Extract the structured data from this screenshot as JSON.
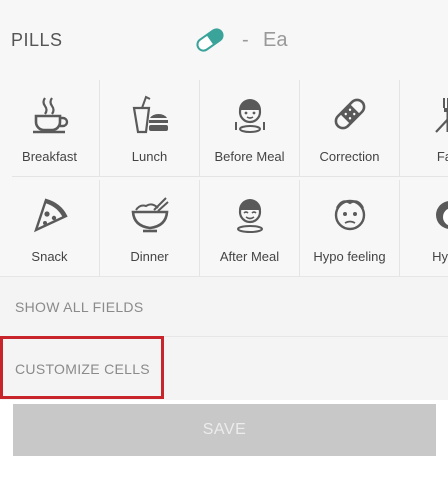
{
  "header": {
    "title": "PILLS",
    "value": "Ea",
    "separator": "-"
  },
  "cells": [
    {
      "label": "Breakfast",
      "icon": "coffee-cup-icon"
    },
    {
      "label": "Lunch",
      "icon": "burger-drink-icon"
    },
    {
      "label": "Before Meal",
      "icon": "person-before-meal-icon"
    },
    {
      "label": "Correction",
      "icon": "bandage-icon"
    },
    {
      "label": "Fast",
      "icon": "fork-knife-icon"
    },
    {
      "label": "Snack",
      "icon": "pizza-slice-icon"
    },
    {
      "label": "Dinner",
      "icon": "bowl-chopsticks-icon"
    },
    {
      "label": "After Meal",
      "icon": "person-after-meal-icon"
    },
    {
      "label": "Hypo feeling",
      "icon": "hypo-face-icon"
    },
    {
      "label": "Hyper",
      "icon": "hyper-face-icon"
    }
  ],
  "fields": {
    "show_all": "SHOW ALL FIELDS",
    "customize": "CUSTOMIZE CELLS"
  },
  "save_label": "SAVE",
  "colors": {
    "pill_teal": "#3aa39a",
    "highlight_red": "#c8242b",
    "icon_gray": "#5a5a5a",
    "save_bg": "#c8c8c8"
  }
}
